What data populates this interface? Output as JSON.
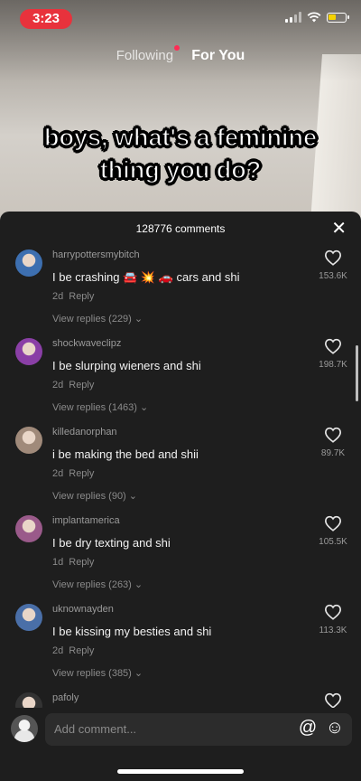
{
  "status_bar": {
    "time": "3:23"
  },
  "feed": {
    "following_label": "Following",
    "for_you_label": "For You"
  },
  "video": {
    "caption_line1": "boys, what's a feminine",
    "caption_line2": "thing you do?"
  },
  "comments": {
    "header": "128776 comments",
    "close_glyph": "✕",
    "items": [
      {
        "username": "harrypottersmybitch",
        "text": "I be crashing 🚘 💥 🚗 cars and shi",
        "age": "2d",
        "reply_label": "Reply",
        "view_replies": "View replies (229) ⌄",
        "likes": "153.6K",
        "avatar_color": "#3d6fb0"
      },
      {
        "username": "shockwaveclipz",
        "text": "I be slurping wieners and shi",
        "age": "2d",
        "reply_label": "Reply",
        "view_replies": "View replies (1463) ⌄",
        "likes": "198.7K",
        "avatar_color": "#8a3fa6"
      },
      {
        "username": "killedanorphan",
        "text": "i be making the bed and shii",
        "age": "2d",
        "reply_label": "Reply",
        "view_replies": "View replies (90) ⌄",
        "likes": "89.7K",
        "avatar_color": "#a08a7a"
      },
      {
        "username": "implantamerica",
        "text": "I be dry texting and shi",
        "age": "1d",
        "reply_label": "Reply",
        "view_replies": "View replies (263) ⌄",
        "likes": "105.5K",
        "avatar_color": "#9a5a8a"
      },
      {
        "username": "uknownayden",
        "text": "I be kissing my besties and shi",
        "age": "2d",
        "reply_label": "Reply",
        "view_replies": "View replies (385) ⌄",
        "likes": "113.3K",
        "avatar_color": "#4a6fa8"
      },
      {
        "username": "pafoly",
        "avatar_color": "#333333"
      }
    ]
  },
  "input": {
    "placeholder": "Add comment...",
    "at_glyph": "@",
    "emoji_glyph": "☺"
  }
}
